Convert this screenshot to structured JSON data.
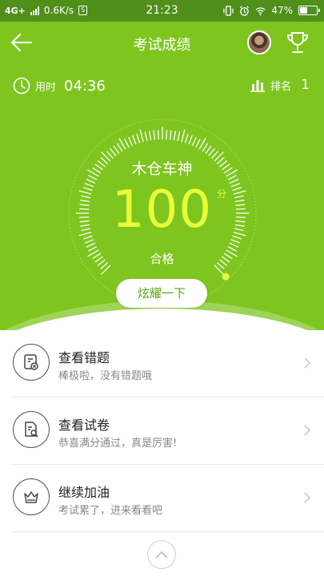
{
  "status_bar": {
    "network": "4G+",
    "speed": "0.6K/s",
    "time": "21:23",
    "battery_text": "47%",
    "battery_level": 0.47
  },
  "header": {
    "title": "考试成绩",
    "back_icon": "back-arrow-icon",
    "trophy_icon": "trophy-icon"
  },
  "stats": {
    "time_label": "用时",
    "time_value": "04:36",
    "rank_label": "排名",
    "rank_value": "1"
  },
  "result": {
    "nickname": "木仓车神",
    "score": "100",
    "score_unit": "分",
    "status": "合格",
    "share_button": "炫耀一下",
    "score_fraction": 1.0
  },
  "actions": [
    {
      "title": "查看错题",
      "subtitle": "棒极啦，没有错题哦",
      "icon": "wrong-questions-icon"
    },
    {
      "title": "查看试卷",
      "subtitle": "恭喜满分通过，真是厉害!",
      "icon": "review-paper-icon"
    },
    {
      "title": "继续加油",
      "subtitle": "考试累了，进来看看吧",
      "icon": "crown-icon"
    }
  ],
  "colors": {
    "hero_green": "#7ec61f",
    "status_green": "#4f8f1a",
    "score_yellow": "#e9ff3a",
    "button_text_green": "#5aa514"
  }
}
